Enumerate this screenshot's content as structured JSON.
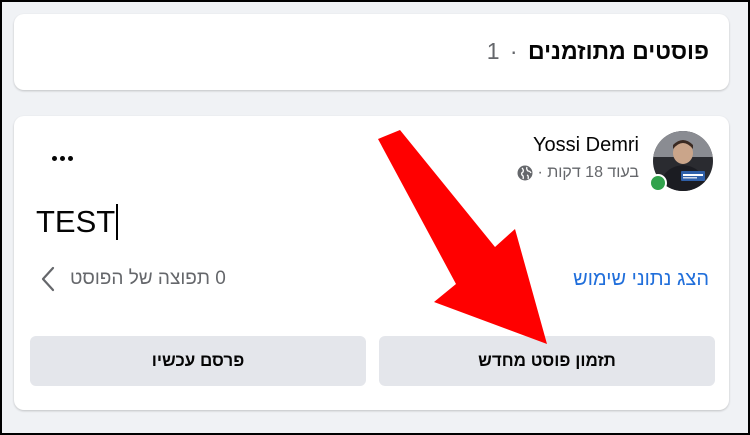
{
  "header": {
    "title": "פוסטים מתוזמנים",
    "separator": "·",
    "count": "1"
  },
  "post": {
    "author": "Yossi Demri",
    "time_text": "בעוד 18 דקות ·",
    "privacy_icon": "globe-icon",
    "online_status": "online",
    "content": "TEST",
    "insights_link": "הצג נתוני שימוש",
    "preview_text": "0 תפוצה של הפוסט"
  },
  "actions": {
    "reschedule_label": "תזמון פוסט מחדש",
    "publish_now_label": "פרסם עכשיו"
  },
  "colors": {
    "background": "#f0f2f5",
    "link": "#216fdb",
    "button_bg": "#e4e6eb",
    "online": "#31a24c",
    "annotation_arrow": "#ff0000"
  }
}
